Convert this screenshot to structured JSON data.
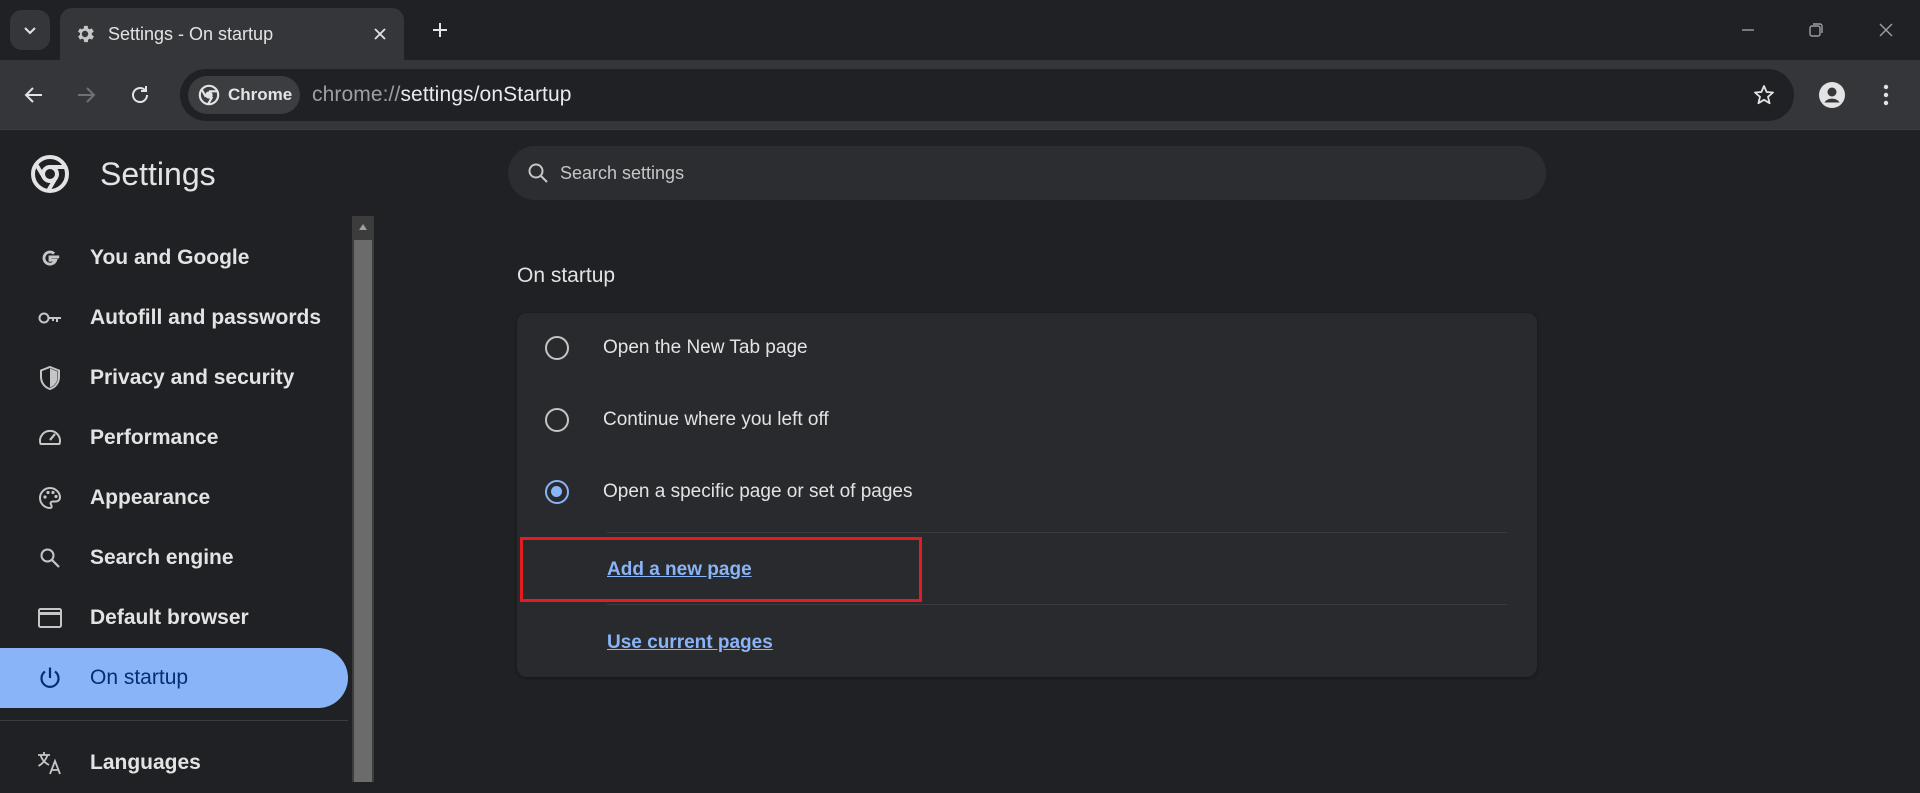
{
  "tab": {
    "title": "Settings - On startup"
  },
  "toolbar": {
    "chip_label": "Chrome",
    "url_scheme": "chrome://",
    "url_host": "settings",
    "url_path": "/onStartup"
  },
  "header": {
    "title": "Settings",
    "search_placeholder": "Search settings"
  },
  "sidebar": {
    "items": [
      {
        "label": "You and Google",
        "icon": "google-g-icon"
      },
      {
        "label": "Autofill and passwords",
        "icon": "key-icon"
      },
      {
        "label": "Privacy and security",
        "icon": "shield-icon"
      },
      {
        "label": "Performance",
        "icon": "speedometer-icon"
      },
      {
        "label": "Appearance",
        "icon": "palette-icon"
      },
      {
        "label": "Search engine",
        "icon": "search-icon"
      },
      {
        "label": "Default browser",
        "icon": "browser-window-icon"
      },
      {
        "label": "On startup",
        "icon": "power-icon",
        "active": true
      },
      {
        "label": "Languages",
        "icon": "translate-icon"
      }
    ]
  },
  "main": {
    "section_title": "On startup",
    "options": [
      {
        "label": "Open the New Tab page",
        "checked": false
      },
      {
        "label": "Continue where you left off",
        "checked": false
      },
      {
        "label": "Open a specific page or set of pages",
        "checked": true
      }
    ],
    "add_page_link": "Add a new page",
    "use_current_link": "Use current pages"
  },
  "colors": {
    "accent": "#8ab4f8",
    "highlight": "#e31b23",
    "background": "#202124",
    "card": "#292a2d"
  }
}
